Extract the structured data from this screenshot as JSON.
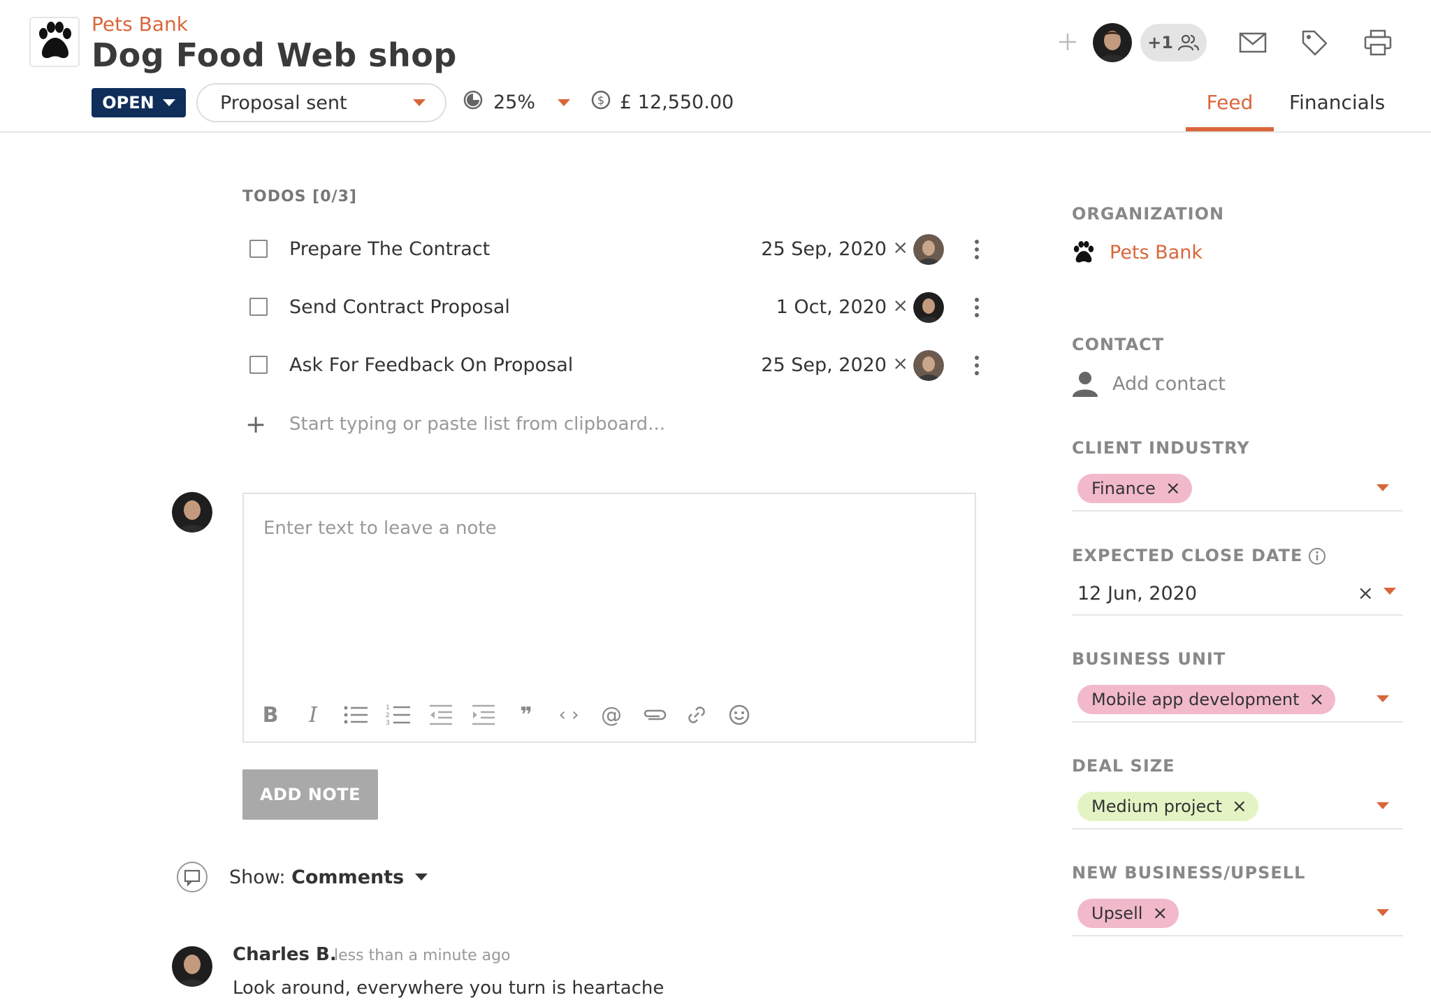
{
  "header": {
    "org_name": "Pets Bank",
    "deal_title": "Dog Food Web shop",
    "status": "OPEN",
    "stage": "Proposal sent",
    "probability": "25%",
    "value": "£ 12,550.00",
    "participants_more": "+1",
    "tabs": [
      {
        "label": "Feed",
        "active": true
      },
      {
        "label": "Financials",
        "active": false
      }
    ]
  },
  "todos": {
    "title": "TODOS [0/3]",
    "items": [
      {
        "label": "Prepare The Contract",
        "date": "25 Sep, 2020",
        "done": false
      },
      {
        "label": "Send Contract Proposal",
        "date": "1 Oct, 2020",
        "done": false
      },
      {
        "label": "Ask For Feedback On Proposal",
        "date": "25 Sep, 2020",
        "done": false
      }
    ],
    "add_placeholder": "Start typing or paste list from clipboard..."
  },
  "note": {
    "placeholder": "Enter text to leave a note",
    "add_button": "ADD NOTE"
  },
  "feed_filter": {
    "prefix": "Show: ",
    "value": "Comments"
  },
  "comments": [
    {
      "author": "Charles B.",
      "time": "less than a minute ago",
      "text": "Look around, everywhere you turn is heartache"
    }
  ],
  "sidebar": {
    "organization": {
      "title": "ORGANIZATION",
      "name": "Pets Bank"
    },
    "contact": {
      "title": "CONTACT",
      "placeholder": "Add contact"
    },
    "client_industry": {
      "title": "CLIENT INDUSTRY",
      "value": "Finance"
    },
    "expected_close": {
      "title": "EXPECTED CLOSE DATE",
      "value": "12 Jun, 2020"
    },
    "business_unit": {
      "title": "BUSINESS UNIT",
      "value": "Mobile app development"
    },
    "deal_size": {
      "title": "DEAL SIZE",
      "value": "Medium project"
    },
    "new_business": {
      "title": "NEW BUSINESS/UPSELL",
      "value": "Upsell"
    }
  },
  "colors": {
    "accent": "#d9663a",
    "status_bg": "#0f2e5a",
    "chip_pink": "#f2b9cb",
    "chip_green": "#e4f3c4"
  },
  "icons": [
    "paw-icon",
    "plus-icon",
    "people-icon",
    "mail-icon",
    "tag-icon",
    "printer-icon",
    "pie-icon",
    "dollar-circle-icon",
    "kebab-icon",
    "person-icon",
    "info-icon",
    "comment-icon"
  ]
}
